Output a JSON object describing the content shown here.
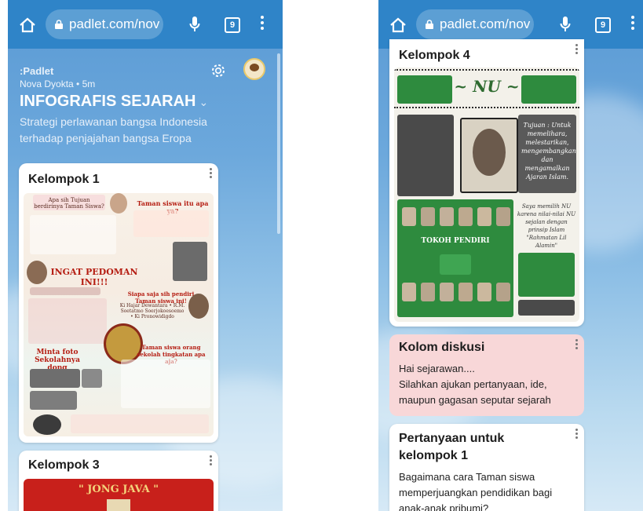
{
  "browser": {
    "url": "padlet.com/nov",
    "tab_count": "9"
  },
  "padlet": {
    "brand": ":Padlet",
    "author": "Nova Dyokta • 5m",
    "title": "INFOGRAFIS SEJARAH",
    "description": "Strategi perlawanan bangsa Indonesia terhadap penjajahan bangsa Eropa"
  },
  "left_cards": {
    "card1_title": "Kelompok 1",
    "card1_infographic": {
      "q1": "Apa sih Tujuan berdirinya Taman Siswa?",
      "q2": "Taman siswa itu apa ya?",
      "heading": "INGAT PEDOMAN INI!!!",
      "q3": "Siapa saja sih pendiri Taman siswa ini!",
      "founders": "Ki Hajar Dewantara • R.M. Soetatmo Soerjokoesoemo • Ki Pronowidigdo",
      "photo": "Minta foto Sekolahnya dong",
      "levels": "Taman siswa orang sekolah tingkatan apa aja?"
    },
    "card3_title": "Kelompok 3",
    "card3_banner": "\" JONG JAVA \""
  },
  "right_cards": {
    "card4_title": "Kelompok 4",
    "card4_infographic": {
      "nu": "~ NU ~",
      "tujuan": "Tujuan : Untuk memelihara, melestarikan, mengembangkan dan mengamalkan Ajaran Islam.",
      "tokoh": "TOKOH PENDIRI",
      "motto": "Saya memilih NU karena nilai-nilai NU sejalan dengan prinsip Islam \"Rahmatan Lil Alamin\""
    },
    "diskusi_title": "Kolom diskusi",
    "diskusi_lines": [
      "Hai sejarawan....",
      "Silahkan ajukan pertanyaan, ide,",
      "maupun gagasan seputar sejarah"
    ],
    "pertanyaan_title_1": "Pertanyaan untuk",
    "pertanyaan_title_2": "kelompok 1",
    "pertanyaan_lines": [
      "Bagaimana cara Taman siswa",
      "memperjuangkan pendidikan bagi",
      "anak-anak pribumi?"
    ]
  },
  "colors": {
    "urlbar": "#2f84c8",
    "note_pink": "#f8d7d8",
    "nu_green": "#2e8b3e",
    "jong_red": "#c8201b"
  }
}
